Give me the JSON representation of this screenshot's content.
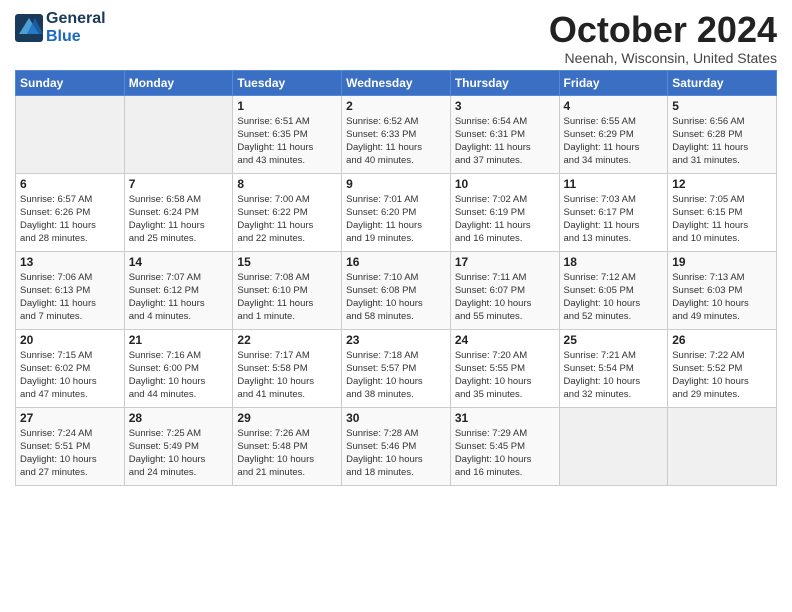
{
  "header": {
    "logo_line1": "General",
    "logo_line2": "Blue",
    "month_title": "October 2024",
    "location": "Neenah, Wisconsin, United States"
  },
  "days_of_week": [
    "Sunday",
    "Monday",
    "Tuesday",
    "Wednesday",
    "Thursday",
    "Friday",
    "Saturday"
  ],
  "weeks": [
    [
      {
        "num": "",
        "info": ""
      },
      {
        "num": "",
        "info": ""
      },
      {
        "num": "1",
        "info": "Sunrise: 6:51 AM\nSunset: 6:35 PM\nDaylight: 11 hours\nand 43 minutes."
      },
      {
        "num": "2",
        "info": "Sunrise: 6:52 AM\nSunset: 6:33 PM\nDaylight: 11 hours\nand 40 minutes."
      },
      {
        "num": "3",
        "info": "Sunrise: 6:54 AM\nSunset: 6:31 PM\nDaylight: 11 hours\nand 37 minutes."
      },
      {
        "num": "4",
        "info": "Sunrise: 6:55 AM\nSunset: 6:29 PM\nDaylight: 11 hours\nand 34 minutes."
      },
      {
        "num": "5",
        "info": "Sunrise: 6:56 AM\nSunset: 6:28 PM\nDaylight: 11 hours\nand 31 minutes."
      }
    ],
    [
      {
        "num": "6",
        "info": "Sunrise: 6:57 AM\nSunset: 6:26 PM\nDaylight: 11 hours\nand 28 minutes."
      },
      {
        "num": "7",
        "info": "Sunrise: 6:58 AM\nSunset: 6:24 PM\nDaylight: 11 hours\nand 25 minutes."
      },
      {
        "num": "8",
        "info": "Sunrise: 7:00 AM\nSunset: 6:22 PM\nDaylight: 11 hours\nand 22 minutes."
      },
      {
        "num": "9",
        "info": "Sunrise: 7:01 AM\nSunset: 6:20 PM\nDaylight: 11 hours\nand 19 minutes."
      },
      {
        "num": "10",
        "info": "Sunrise: 7:02 AM\nSunset: 6:19 PM\nDaylight: 11 hours\nand 16 minutes."
      },
      {
        "num": "11",
        "info": "Sunrise: 7:03 AM\nSunset: 6:17 PM\nDaylight: 11 hours\nand 13 minutes."
      },
      {
        "num": "12",
        "info": "Sunrise: 7:05 AM\nSunset: 6:15 PM\nDaylight: 11 hours\nand 10 minutes."
      }
    ],
    [
      {
        "num": "13",
        "info": "Sunrise: 7:06 AM\nSunset: 6:13 PM\nDaylight: 11 hours\nand 7 minutes."
      },
      {
        "num": "14",
        "info": "Sunrise: 7:07 AM\nSunset: 6:12 PM\nDaylight: 11 hours\nand 4 minutes."
      },
      {
        "num": "15",
        "info": "Sunrise: 7:08 AM\nSunset: 6:10 PM\nDaylight: 11 hours\nand 1 minute."
      },
      {
        "num": "16",
        "info": "Sunrise: 7:10 AM\nSunset: 6:08 PM\nDaylight: 10 hours\nand 58 minutes."
      },
      {
        "num": "17",
        "info": "Sunrise: 7:11 AM\nSunset: 6:07 PM\nDaylight: 10 hours\nand 55 minutes."
      },
      {
        "num": "18",
        "info": "Sunrise: 7:12 AM\nSunset: 6:05 PM\nDaylight: 10 hours\nand 52 minutes."
      },
      {
        "num": "19",
        "info": "Sunrise: 7:13 AM\nSunset: 6:03 PM\nDaylight: 10 hours\nand 49 minutes."
      }
    ],
    [
      {
        "num": "20",
        "info": "Sunrise: 7:15 AM\nSunset: 6:02 PM\nDaylight: 10 hours\nand 47 minutes."
      },
      {
        "num": "21",
        "info": "Sunrise: 7:16 AM\nSunset: 6:00 PM\nDaylight: 10 hours\nand 44 minutes."
      },
      {
        "num": "22",
        "info": "Sunrise: 7:17 AM\nSunset: 5:58 PM\nDaylight: 10 hours\nand 41 minutes."
      },
      {
        "num": "23",
        "info": "Sunrise: 7:18 AM\nSunset: 5:57 PM\nDaylight: 10 hours\nand 38 minutes."
      },
      {
        "num": "24",
        "info": "Sunrise: 7:20 AM\nSunset: 5:55 PM\nDaylight: 10 hours\nand 35 minutes."
      },
      {
        "num": "25",
        "info": "Sunrise: 7:21 AM\nSunset: 5:54 PM\nDaylight: 10 hours\nand 32 minutes."
      },
      {
        "num": "26",
        "info": "Sunrise: 7:22 AM\nSunset: 5:52 PM\nDaylight: 10 hours\nand 29 minutes."
      }
    ],
    [
      {
        "num": "27",
        "info": "Sunrise: 7:24 AM\nSunset: 5:51 PM\nDaylight: 10 hours\nand 27 minutes."
      },
      {
        "num": "28",
        "info": "Sunrise: 7:25 AM\nSunset: 5:49 PM\nDaylight: 10 hours\nand 24 minutes."
      },
      {
        "num": "29",
        "info": "Sunrise: 7:26 AM\nSunset: 5:48 PM\nDaylight: 10 hours\nand 21 minutes."
      },
      {
        "num": "30",
        "info": "Sunrise: 7:28 AM\nSunset: 5:46 PM\nDaylight: 10 hours\nand 18 minutes."
      },
      {
        "num": "31",
        "info": "Sunrise: 7:29 AM\nSunset: 5:45 PM\nDaylight: 10 hours\nand 16 minutes."
      },
      {
        "num": "",
        "info": ""
      },
      {
        "num": "",
        "info": ""
      }
    ]
  ]
}
